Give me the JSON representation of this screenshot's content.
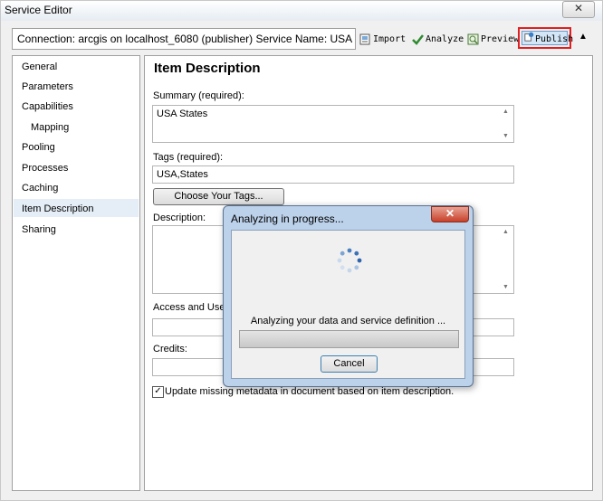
{
  "window": {
    "title": "Service Editor",
    "close_glyph": "✕"
  },
  "toolbar": {
    "connection_text": "Connection: arcgis on localhost_6080 (publisher)   Service Name: USA",
    "import_label": "Import",
    "analyze_label": "Analyze",
    "preview_label": "Preview",
    "publish_label": "Publish",
    "collapse_glyph": "▲"
  },
  "sidebar": {
    "items": [
      {
        "label": "General"
      },
      {
        "label": "Parameters"
      },
      {
        "label": "Capabilities"
      },
      {
        "label": "Mapping"
      },
      {
        "label": "Pooling"
      },
      {
        "label": "Processes"
      },
      {
        "label": "Caching"
      },
      {
        "label": "Item Description"
      },
      {
        "label": "Sharing"
      }
    ],
    "selected": "Item Description"
  },
  "main": {
    "heading": "Item Description",
    "summary_label": "Summary (required):",
    "summary_value": "USA States",
    "tags_label": "Tags (required):",
    "tags_value": "USA,States",
    "choose_tags_label": "Choose Your Tags...",
    "description_label": "Description:",
    "access_label": "Access and Use Co",
    "credits_label": "Credits:",
    "update_checkbox_label": "Update missing metadata in document based on item description.",
    "update_checked": true
  },
  "dialog": {
    "title": "Analyzing in progress...",
    "close_glyph": "✕",
    "message": "Analyzing your data and service definition ...",
    "progress": 0,
    "cancel_label": "Cancel"
  }
}
